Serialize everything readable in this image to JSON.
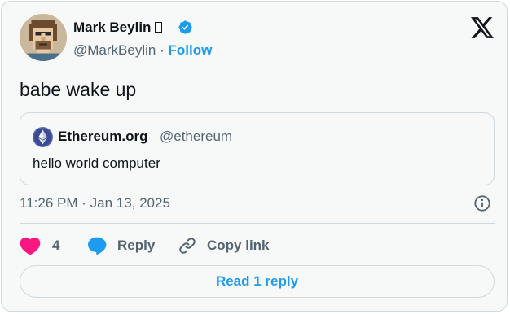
{
  "author": {
    "name": "Mark Beylin",
    "name_suffix_glyph": "missing-glyph-box",
    "handle": "@MarkBeylin",
    "separator": "·",
    "follow_label": "Follow",
    "verified": true,
    "avatar_icon": "pixel-punk-avatar"
  },
  "platform_icon": "x-logo-icon",
  "tweet": {
    "text": "babe wake up"
  },
  "quote": {
    "name": "Ethereum.org",
    "handle": "@ethereum",
    "text": "hello world computer",
    "avatar_icon": "ethereum-logo"
  },
  "meta": {
    "timestamp": "11:26 PM · Jan 13, 2025",
    "info_icon": "info-icon"
  },
  "actions": {
    "like_count": "4",
    "reply_label": "Reply",
    "copy_link_label": "Copy link"
  },
  "read_replies_label": "Read 1 reply",
  "colors": {
    "accent": "#1d9bf0",
    "like": "#f91880",
    "text": "#0f1419",
    "secondary": "#536471",
    "border": "#cfd9de",
    "background": "#f7f9f9"
  }
}
